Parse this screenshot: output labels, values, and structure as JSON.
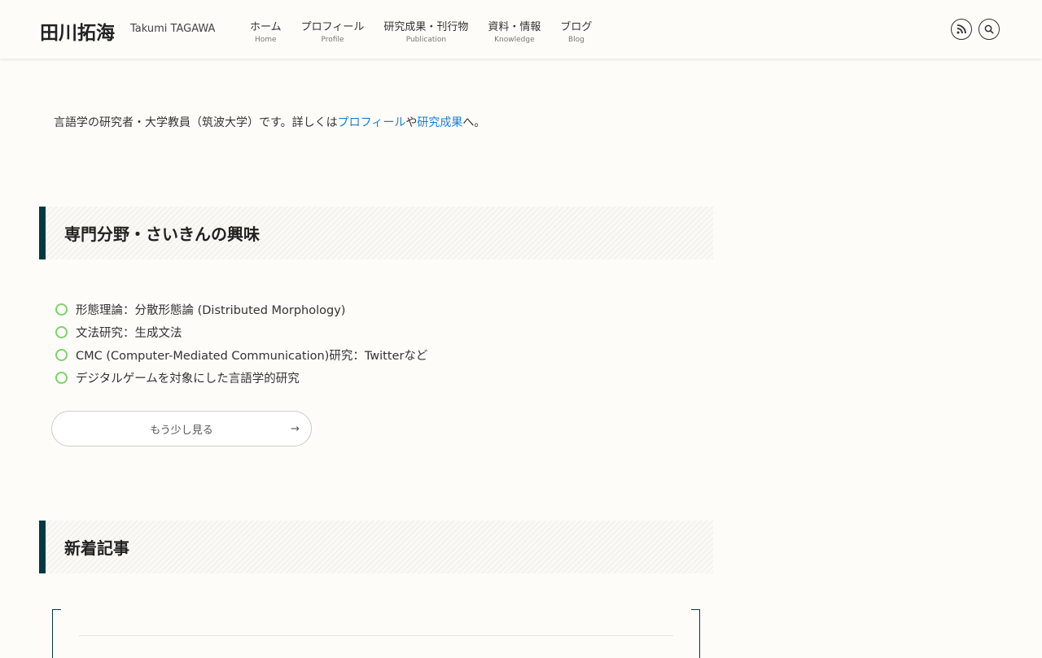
{
  "header": {
    "logo": "田川拓海",
    "subtitle": "Takumi TAGAWA",
    "nav": [
      {
        "jp": "ホーム",
        "en": "Home"
      },
      {
        "jp": "プロフィール",
        "en": "Profile"
      },
      {
        "jp": "研究成果・刊行物",
        "en": "Publication"
      },
      {
        "jp": "資料・情報",
        "en": "Knowledge"
      },
      {
        "jp": "ブログ",
        "en": "Blog"
      }
    ],
    "icons": [
      "rss-icon",
      "search-icon"
    ]
  },
  "intro": {
    "text1": "言語学の研究者・大学教員（筑波大学）です。詳しくは",
    "link1": "プロフィール",
    "text2": "や",
    "link2": "研究成果",
    "text3": "へ。"
  },
  "section1": {
    "title": "専門分野・さいきんの興味",
    "items": [
      "形態理論：分散形態論 (Distributed Morphology)",
      "文法研究：生成文法",
      "CMC (Computer-Mediated Communication)研究：Twitterなど",
      "デジタルゲームを対象にした言語学的研究"
    ],
    "more": "もう少し見る",
    "more_arrow": "→"
  },
  "section2": {
    "title": "新着記事"
  }
}
